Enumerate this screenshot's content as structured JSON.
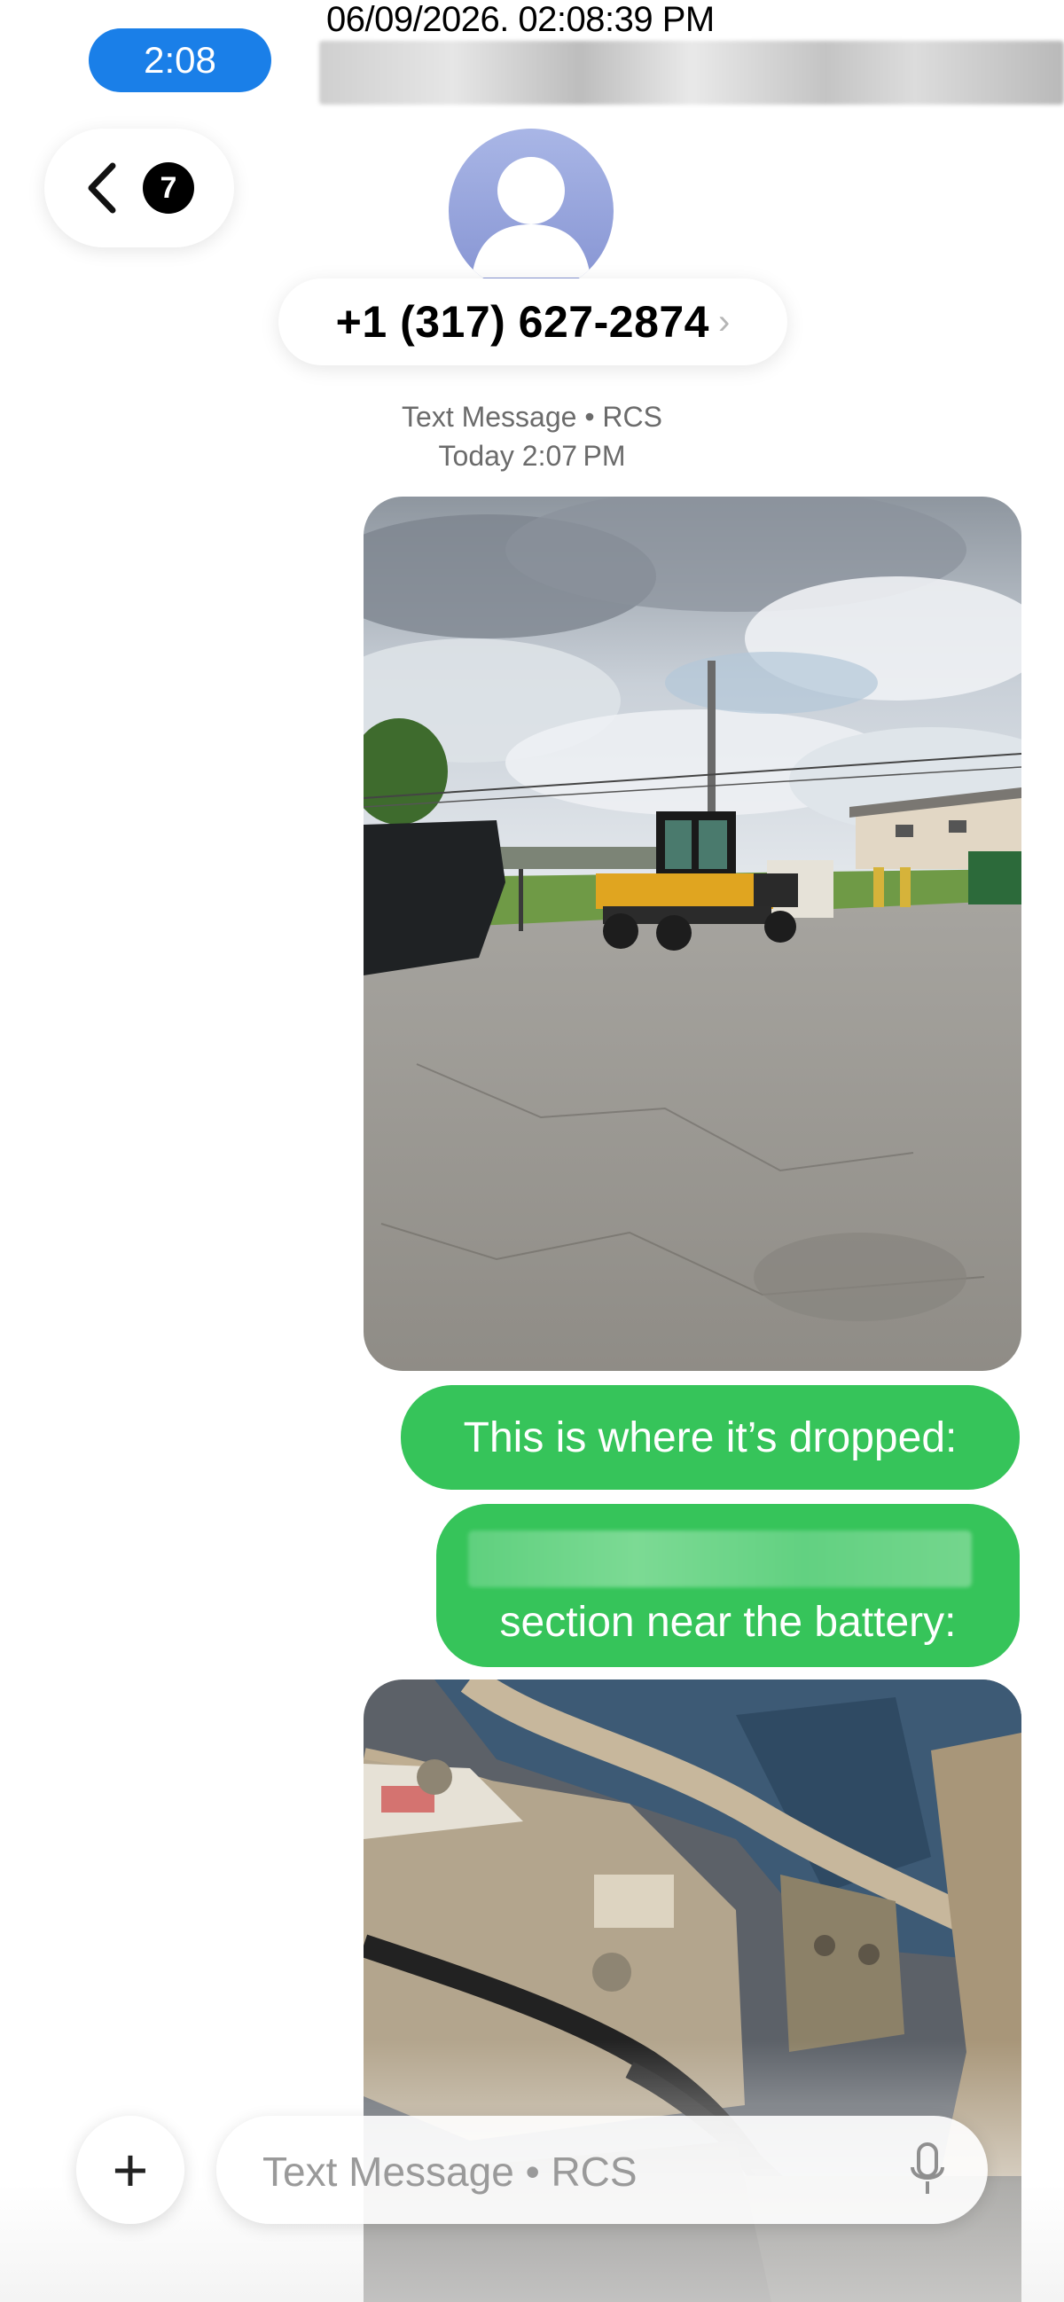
{
  "status_bar": {
    "time": "2:08",
    "screenshot_timestamp": "06/09/2026. 02:08:39 PM"
  },
  "header": {
    "back_badge_count": "7",
    "contact_number": "+1 (317) 627-2874",
    "contact_chevron": "›"
  },
  "conversation": {
    "service_label": "Text Message • RCS",
    "timestamp": "Today 2:07 PM",
    "messages": [
      {
        "type": "image",
        "description_icon": "photo-dropoff"
      },
      {
        "type": "text",
        "text": "This is where it’s dropped:"
      },
      {
        "type": "text",
        "text_visible": "section near the battery:"
      },
      {
        "type": "image",
        "description_icon": "photo-battery"
      }
    ]
  },
  "composer": {
    "placeholder": "Text Message • RCS",
    "plus_label": "+"
  },
  "colors": {
    "sent_bubble": "#36c45a",
    "time_pill": "#1a7fe8",
    "avatar": "#8593d2"
  }
}
